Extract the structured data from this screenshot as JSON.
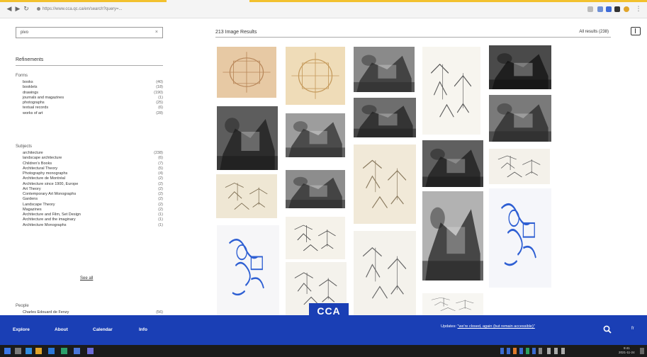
{
  "browser": {
    "address": "https://www.cca.qc.ca/en/search?query=...",
    "progress_percent": 100
  },
  "sidebar": {
    "search": {
      "value": "pivo",
      "clear_glyph": "×"
    },
    "refinements_label": "Refinements",
    "facets": [
      {
        "title": "Forms",
        "items": [
          {
            "label": "books",
            "count": "(40)"
          },
          {
            "label": "booklets",
            "count": "(18)"
          },
          {
            "label": "drawings",
            "count": "(190)"
          },
          {
            "label": "journals and magazines",
            "count": "(1)"
          },
          {
            "label": "photographs",
            "count": "(25)"
          },
          {
            "label": "textual records",
            "count": "(6)"
          },
          {
            "label": "works of art",
            "count": "(28)"
          }
        ]
      },
      {
        "title": "Subjects",
        "items": [
          {
            "label": "architecture",
            "count": "(238)"
          },
          {
            "label": "landscape architecture",
            "count": "(6)"
          },
          {
            "label": "Children's Books",
            "count": "(7)"
          },
          {
            "label": "Architectural Theory",
            "count": "(5)"
          },
          {
            "label": "Photography monographs",
            "count": "(4)"
          },
          {
            "label": "Architecture de Montréal",
            "count": "(2)"
          },
          {
            "label": "Architecture since 1900, Europe",
            "count": "(2)"
          },
          {
            "label": "Art Theory",
            "count": "(2)"
          },
          {
            "label": "Contemporary Art Monographs",
            "count": "(2)"
          },
          {
            "label": "Gardens",
            "count": "(2)"
          },
          {
            "label": "Landscape Theory",
            "count": "(2)"
          },
          {
            "label": "Magazines",
            "count": "(2)"
          },
          {
            "label": "Architecture and Film, Set Design",
            "count": "(1)"
          },
          {
            "label": "Architecture and the imaginary",
            "count": "(1)"
          },
          {
            "label": "Architecture Monographs",
            "count": "(1)"
          }
        ]
      },
      {
        "title": "People",
        "items": [
          {
            "label": "Charles Edouard de Fenzy",
            "count": "(56)"
          }
        ]
      }
    ],
    "see_all": "See all"
  },
  "results": {
    "title": "213 Image Results",
    "all_results": "All results (238)",
    "layout_icon": "layout-toggle-icon",
    "thumbnails": [
      {
        "kind": "sketch-orange",
        "bg": "#e7c9a4",
        "ink": "#b8875a"
      },
      {
        "kind": "sketch-orange",
        "bg": "#efdcb8",
        "ink": "#c59a5c"
      },
      {
        "kind": "photo-bw",
        "bg": "#8a8a8a",
        "ink": "#2b2b2b"
      },
      {
        "kind": "sketch-line",
        "bg": "#f7f5ef",
        "ink": "#5a5a5a"
      },
      {
        "kind": "photo-bw",
        "bg": "#4a4a4a",
        "ink": "#111111"
      },
      {
        "kind": "photo-bw",
        "bg": "#5d5d5d",
        "ink": "#1c1c1c"
      },
      {
        "kind": "photo-bw",
        "bg": "#9d9d9d",
        "ink": "#303030"
      },
      {
        "kind": "photo-bw",
        "bg": "#6e6e6e",
        "ink": "#222222"
      },
      {
        "kind": "photo-bw",
        "bg": "#5f5f5f",
        "ink": "#1b1b1b"
      },
      {
        "kind": "photo-bw",
        "bg": "#7a7a7a",
        "ink": "#2a2a2a"
      },
      {
        "kind": "sketch-line",
        "bg": "#efe7d4",
        "ink": "#7a6a4e"
      },
      {
        "kind": "photo-bw",
        "bg": "#8d8d8d",
        "ink": "#2c2c2c"
      },
      {
        "kind": "sketch-line",
        "bg": "#f1e9d8",
        "ink": "#8a7a5e"
      },
      {
        "kind": "sketch-line",
        "bg": "#f4f1ea",
        "ink": "#555555"
      },
      {
        "kind": "sketch-blue",
        "bg": "#f6f6f8",
        "ink": "#2e5fd3"
      },
      {
        "kind": "sketch-line",
        "bg": "#f5f2ea",
        "ink": "#444444"
      },
      {
        "kind": "sketch-line",
        "bg": "#f4f2ec",
        "ink": "#666666"
      },
      {
        "kind": "photo-bw",
        "bg": "#b2b2b2",
        "ink": "#222222"
      },
      {
        "kind": "sketch-blue",
        "bg": "#f5f6fa",
        "ink": "#2e5fd3"
      },
      {
        "kind": "sketch-line",
        "bg": "#f4f2ec",
        "ink": "#555555"
      },
      {
        "kind": "sketch-line",
        "bg": "#f7f6f2",
        "ink": "#777777"
      }
    ]
  },
  "footer": {
    "links": [
      "Explore",
      "About",
      "Calendar",
      "Info"
    ],
    "logo": "CCA",
    "update_prefix": "Updates: ",
    "update_link": "\"we're closed, again (but remain accessible)\"",
    "search_icon": "search-icon",
    "language": "fr"
  },
  "taskbar": {
    "clock_time": "9:41",
    "clock_date": "2021-11-24"
  },
  "colors": {
    "accent": "#1a3fb5",
    "progress": "#f2c12e",
    "taskbar": "#1b1b1b"
  }
}
